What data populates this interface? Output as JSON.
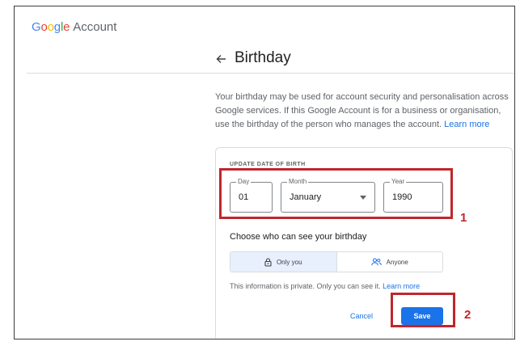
{
  "brand": {
    "letters": [
      {
        "ch": "G",
        "color": "#4285F4"
      },
      {
        "ch": "o",
        "color": "#EA4335"
      },
      {
        "ch": "o",
        "color": "#FBBC05"
      },
      {
        "ch": "g",
        "color": "#4285F4"
      },
      {
        "ch": "l",
        "color": "#34A853"
      },
      {
        "ch": "e",
        "color": "#EA4335"
      }
    ],
    "suffix": "Account"
  },
  "header": {
    "back_icon": "arrow-left-icon",
    "title": "Birthday"
  },
  "description": {
    "text": "Your birthday may be used for account security and personalisation across Google services. If this Google Account is for a business or organisation, use the birthday of the person who manages the account.",
    "link": "Learn more"
  },
  "form": {
    "section_label": "UPDATE DATE OF BIRTH",
    "day": {
      "label": "Day",
      "value": "01"
    },
    "month": {
      "label": "Month",
      "value": "January"
    },
    "year": {
      "label": "Year",
      "value": "1990"
    }
  },
  "visibility": {
    "heading": "Choose who can see your birthday",
    "options": [
      {
        "label": "Only you",
        "icon": "lock-icon",
        "selected": true
      },
      {
        "label": "Anyone",
        "icon": "people-icon",
        "selected": false
      }
    ],
    "info_text": "This information is private. Only you can see it.",
    "info_link": "Learn more"
  },
  "actions": {
    "cancel_label": "Cancel",
    "save_label": "Save"
  },
  "annotations": {
    "marker_1": "1",
    "marker_2": "2",
    "color": "#c0262d"
  }
}
